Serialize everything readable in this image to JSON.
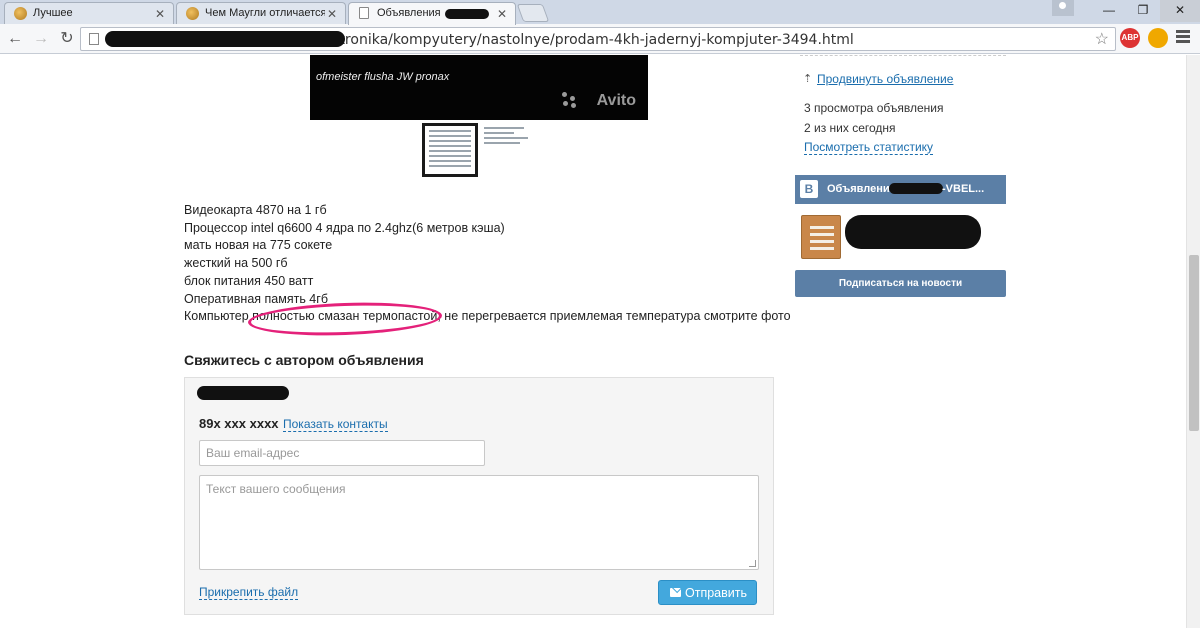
{
  "browser": {
    "tabs": [
      {
        "label": "Лучшее",
        "active": false
      },
      {
        "label": "Чем Маугли отличается",
        "active": false
      },
      {
        "label": "Объявления",
        "active": true
      }
    ],
    "address_url": "search/elektronika/kompyutery/nastolnye/prodam-4kh-jadernyj-kompjuter-3494.html",
    "ext_abp": "ABP"
  },
  "photo": {
    "overlay_text": "ofmeister flusha JW pronax",
    "watermark": "Avito"
  },
  "description": {
    "lines": [
      "Видеокарта 4870 на 1 гб",
      "Процессор intel q6600 4 ядра по 2.4ghz(6 метров кэша)",
      "мать новая на 775 сокете",
      "жесткий на 500 гб",
      "блок питания 450 ватт",
      "Оперативная память 4гб",
      "Компьютер полностью смазан термопастой, не перегревается приемлемая температура смотрите фото"
    ]
  },
  "contact": {
    "title": "Свяжитесь с автором объявления",
    "phone": "89x xxx xxxx",
    "show_contacts": "Показать контакты",
    "email_placeholder": "Ваш email-адрес",
    "message_placeholder": "Текст вашего сообщения",
    "attach_file": "Прикрепить файл",
    "send_label": "Отправить"
  },
  "sidebar": {
    "promote_link": "Продвинуть объявление",
    "views_total": "3 просмотра объявления",
    "views_today": "2 из них сегодня",
    "stats_link": "Посмотреть статистику",
    "vk": {
      "logo": "B",
      "title": "Объявления",
      "title_end": "-VBEL...",
      "subscribe": "Подписаться на новости"
    }
  },
  "colors": {
    "link": "#1a6dad",
    "vk_blue": "#5b7fa6",
    "send_button": "#43a8dd",
    "highlight": "#e4217a"
  }
}
